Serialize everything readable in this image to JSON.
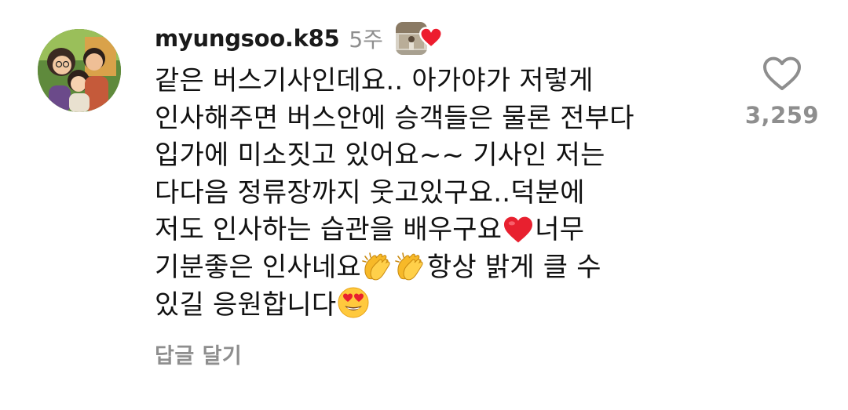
{
  "comment": {
    "username": "myungsoo.k85",
    "time": "5주",
    "body_lines": [
      "같은 버스기사인데요.. 아가야가 저렇게",
      "인사해주면 버스안에 승객들은 물론 전부다",
      "입가에 미소짓고 있어요~~ 기사인 저는",
      "다다음 정류장까지 웃고있구요..덕분에"
    ],
    "line5": {
      "before": "저도 인사하는 습관을 배우구요",
      "after": "너무"
    },
    "line6": {
      "before": "기분좋은 인사네요",
      "after": "항상 밝게 클 수"
    },
    "line7": {
      "before": "있길 응원합니다"
    },
    "reply_label": "답글 달기",
    "like_count": "3,259"
  },
  "icons": {
    "avatar": "family-illustration-avatar",
    "liked_by_author": "red-heart-icon",
    "like": "heart-outline-icon",
    "emojis": [
      "red-heart-emoji",
      "clapping-hands-emoji",
      "clapping-hands-emoji",
      "heart-eyes-emoji"
    ]
  },
  "colors": {
    "text": "#111111",
    "secondary": "#8e8e8e",
    "heart": "#ed1c2e",
    "emoji_yellow": "#ffc93d"
  }
}
